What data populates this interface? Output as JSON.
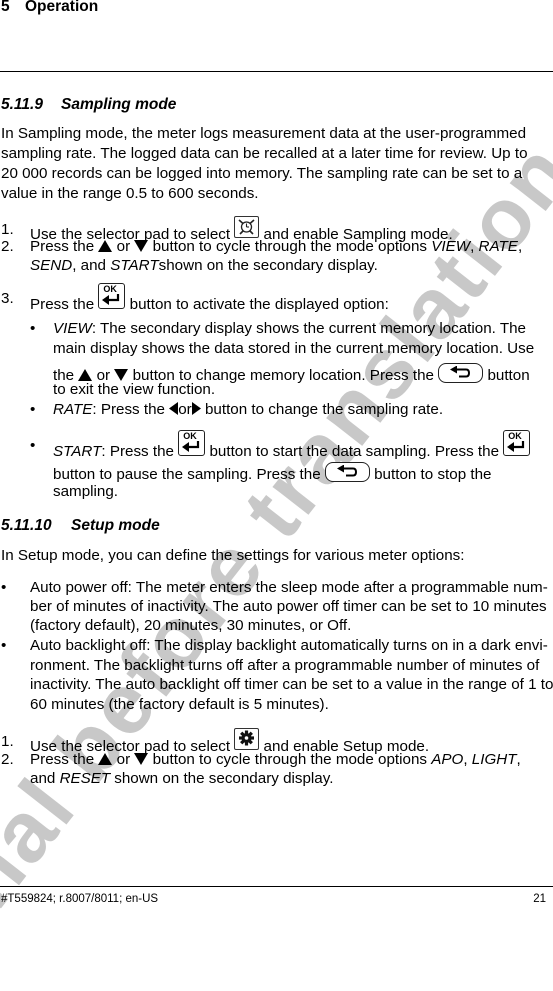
{
  "header": {
    "chapter_number": "5",
    "chapter_title": "Operation"
  },
  "watermark": "Final before translation",
  "sampling": {
    "number": "5.11.9",
    "title": "Sampling mode",
    "intro_lines": [
      "In Sampling mode, the meter logs measurement data at the user-programmed",
      "sampling rate. The logged data can be recalled at a later time for review. Up to",
      "20 000 records can be logged into memory. The sampling rate can be set to a",
      "value in the range 0.5 to 600 seconds."
    ],
    "steps": [
      {
        "marker": "1.",
        "before": "Use the selector pad to select",
        "after": "and enable Sampling mode.",
        "icon": "sampling-icon"
      },
      {
        "marker": "2.",
        "a": "Press the",
        "b": "or",
        "c": "button to cycle through the mode options",
        "opt1": "VIEW",
        "sep1": ",",
        "opt2": "RATE",
        "sep2": ",",
        "line2_opt3": "SEND",
        "line2_mid": ", and",
        "line2_opt4": "START",
        "line2_end": "shown on the secondary display."
      },
      {
        "marker": "3.",
        "before": "Press the",
        "after": "button to activate the displayed option:",
        "icon": "ok-enter-key"
      }
    ],
    "options": {
      "view": {
        "label": "VIEW",
        "line1": ": The secondary display shows the current memory location. The",
        "line2": "main display shows the data stored in the current memory location. Use",
        "line3_a": "the",
        "line3_b": "or",
        "line3_c": "button to change memory location. Press the",
        "line3_d": "button",
        "line4": "to exit the view function."
      },
      "rate": {
        "label": "RATE",
        "a": ": Press the",
        "b": "or",
        "c": "button to change the sampling rate."
      },
      "start": {
        "label": "START",
        "a": ": Press the",
        "b": "button to start the data sampling. Press the",
        "line2_a": "button to pause the sampling. Press the",
        "line2_b": "button to stop the",
        "line3": "sampling."
      }
    },
    "bullet": "•",
    "ok_key_label": "OK"
  },
  "setup": {
    "number": "5.11.10",
    "title": "Setup mode",
    "intro": "In Setup mode, you can define the settings for various meter options:",
    "bullets": [
      {
        "lines": [
          "Auto power off: The meter enters the sleep mode after a programmable num-",
          "ber of minutes of inactivity. The auto power off timer can be set to 10 minutes",
          "(factory default), 20 minutes, 30 minutes, or Off."
        ]
      },
      {
        "lines": [
          "Auto backlight off: The display backlight automatically turns on in a dark envi-",
          "ronment. The backlight turns off after a programmable number of minutes of",
          "inactivity. The auto backlight off timer can be set to a value in the range of 1 to",
          "60 minutes (the factory default is 5 minutes)."
        ]
      }
    ],
    "steps": [
      {
        "marker": "1.",
        "before": "Use the selector pad to select",
        "after": "and enable Setup mode.",
        "icon": "setup-gear-icon"
      },
      {
        "marker": "2.",
        "a": "Press the",
        "b": "or",
        "c": "button to cycle through the mode options",
        "opt1": "APO",
        "sep1": ",",
        "opt2": "LIGHT",
        "sep2": ",",
        "line2_a": "and",
        "line2_opt3": "RESET",
        "line2_end": "shown on the secondary display."
      }
    ]
  },
  "footer": {
    "doc_id": "#T559824; r.8007/8011; en-US",
    "page": "21"
  }
}
